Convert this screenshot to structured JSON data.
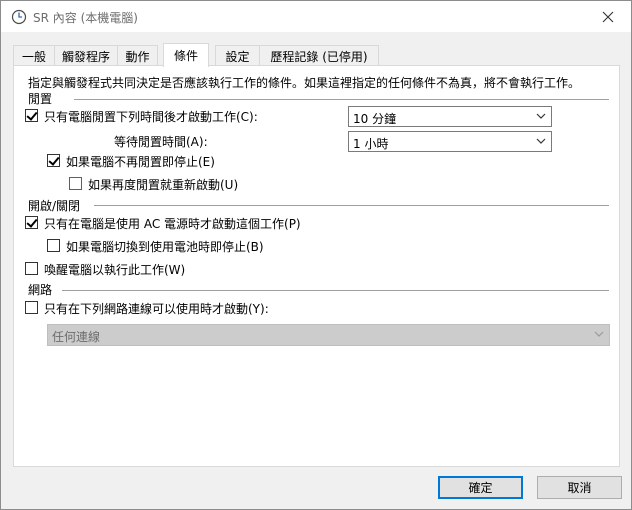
{
  "window": {
    "title": "SR 內容 (本機電腦)"
  },
  "tabs": [
    "一般",
    "觸發程序",
    "動作",
    "條件",
    "設定",
    "歷程記錄 (已停用)"
  ],
  "conditions": {
    "description": "指定與觸發程式共同決定是否應該執行工作的條件。如果這裡指定的任何條件不為真，將不會執行工作。",
    "idle": {
      "section_label": "閒置",
      "start_if_idle_label": "只有電腦閒置下列時間後才啟動工作(C):",
      "start_if_idle_checked": true,
      "idle_duration_value": "10 分鐘",
      "wait_for_idle_label": "等待閒置時間(A):",
      "wait_for_idle_value": "1 小時",
      "stop_if_not_idle_label": "如果電腦不再閒置即停止(E)",
      "stop_if_not_idle_checked": true,
      "restart_if_idle_label": "如果再度閒置就重新啟動(U)",
      "restart_if_idle_checked": false
    },
    "power": {
      "section_label": "開啟/關閉",
      "ac_power_label": "只有在電腦是使用 AC 電源時才啟動這個工作(P)",
      "ac_power_checked": true,
      "battery_stop_label": "如果電腦切換到使用電池時即停止(B)",
      "battery_stop_checked": false,
      "wake_label": "喚醒電腦以執行此工作(W)",
      "wake_checked": false
    },
    "network": {
      "section_label": "網路",
      "network_label": "只有在下列網路連線可以使用時才啟動(Y):",
      "network_checked": false,
      "connection_value": "任何連線"
    }
  },
  "buttons": {
    "ok": "確定",
    "cancel": "取消"
  },
  "colors": {
    "accent": "#0078d7"
  }
}
